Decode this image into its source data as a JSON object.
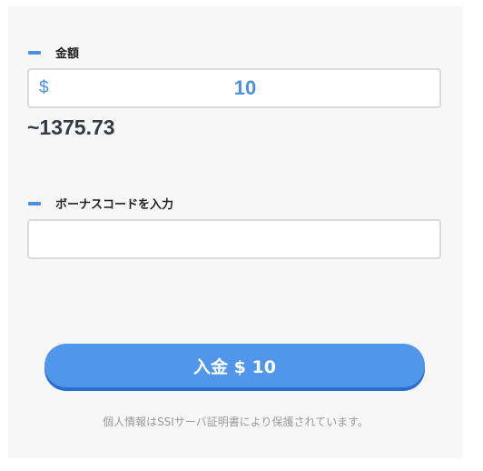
{
  "amount_section": {
    "label": "金額",
    "currency_symbol": "$",
    "amount_value": "10",
    "converted_amount": "~1375.73"
  },
  "bonus_section": {
    "label": "ボーナスコードを入力",
    "input_value": ""
  },
  "deposit_button": {
    "label": "入金 $ 10"
  },
  "security_note": "個人情報はSSIサーバ証明書により保護されています。",
  "colors": {
    "accent": "#4d8fe0",
    "button": "#5096ea",
    "panel_background": "#f7f7f7",
    "text_dark": "#333a44"
  }
}
